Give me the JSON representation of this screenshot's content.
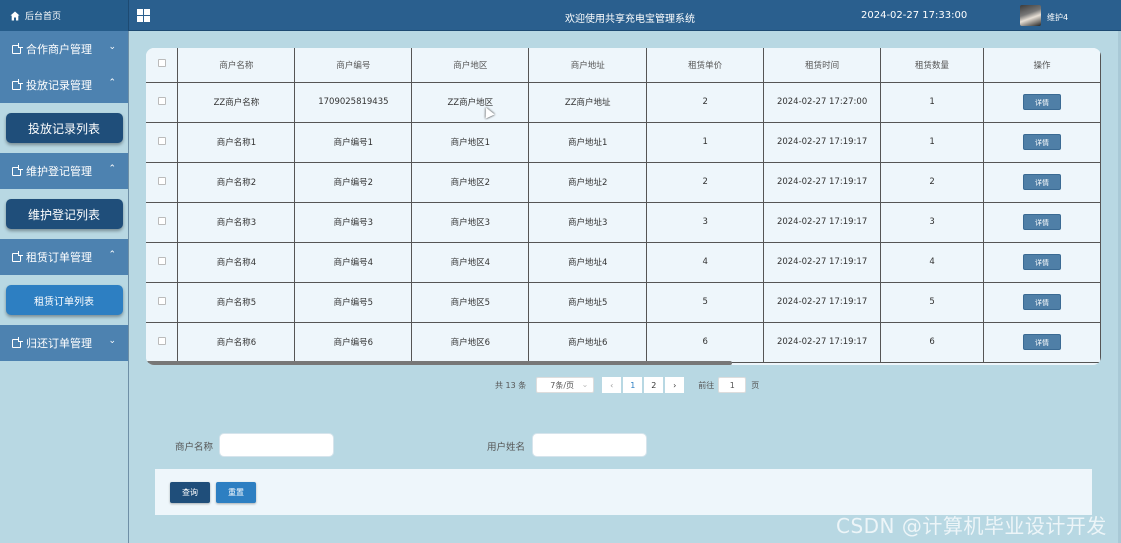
{
  "topbar": {
    "home_label": "后台首页",
    "welcome": "欢迎使用共享充电宝管理系统",
    "datetime": "2024-02-27 17:33:00",
    "username": "维护4"
  },
  "sidebar": {
    "menus": [
      {
        "label": "合作商户管理",
        "chevron": "⌄",
        "sub": null
      },
      {
        "label": "投放记录管理",
        "chevron": "⌃",
        "sub": "投放记录列表"
      },
      {
        "label": "维护登记管理",
        "chevron": "⌃",
        "sub": "维护登记列表"
      },
      {
        "label": "租赁订单管理",
        "chevron": "⌃",
        "sub": "租赁订单列表"
      },
      {
        "label": "归还订单管理",
        "chevron": "⌄",
        "sub": null
      }
    ]
  },
  "table": {
    "headers": [
      "商户名称",
      "商户编号",
      "商户地区",
      "商户地址",
      "租赁单价",
      "租赁时间",
      "租赁数量",
      "操作"
    ],
    "detail_label": "详情",
    "rows": [
      [
        "ZZ商户名称",
        "1709025819435",
        "ZZ商户地区",
        "ZZ商户地址",
        "2",
        "2024-02-27 17:27:00",
        "1"
      ],
      [
        "商户名称1",
        "商户编号1",
        "商户地区1",
        "商户地址1",
        "1",
        "2024-02-27 17:19:17",
        "1"
      ],
      [
        "商户名称2",
        "商户编号2",
        "商户地区2",
        "商户地址2",
        "2",
        "2024-02-27 17:19:17",
        "2"
      ],
      [
        "商户名称3",
        "商户编号3",
        "商户地区3",
        "商户地址3",
        "3",
        "2024-02-27 17:19:17",
        "3"
      ],
      [
        "商户名称4",
        "商户编号4",
        "商户地区4",
        "商户地址4",
        "4",
        "2024-02-27 17:19:17",
        "4"
      ],
      [
        "商户名称5",
        "商户编号5",
        "商户地区5",
        "商户地址5",
        "5",
        "2024-02-27 17:19:17",
        "5"
      ],
      [
        "商户名称6",
        "商户编号6",
        "商户地区6",
        "商户地址6",
        "6",
        "2024-02-27 17:19:17",
        "6"
      ]
    ]
  },
  "pagination": {
    "total": "共 13 条",
    "page_size": "7条/页",
    "prev": "‹",
    "pages": [
      "1",
      "2"
    ],
    "active_page": "1",
    "next": "›",
    "goto_label": "前往",
    "goto_value": "1",
    "goto_suffix": "页"
  },
  "search": {
    "merchant_label": "商户名称",
    "merchant_value": "",
    "user_label": "用户姓名",
    "user_value": "",
    "query_label": "查询",
    "reset_label": "重置"
  },
  "watermark": "CSDN @计算机毕业设计开发"
}
